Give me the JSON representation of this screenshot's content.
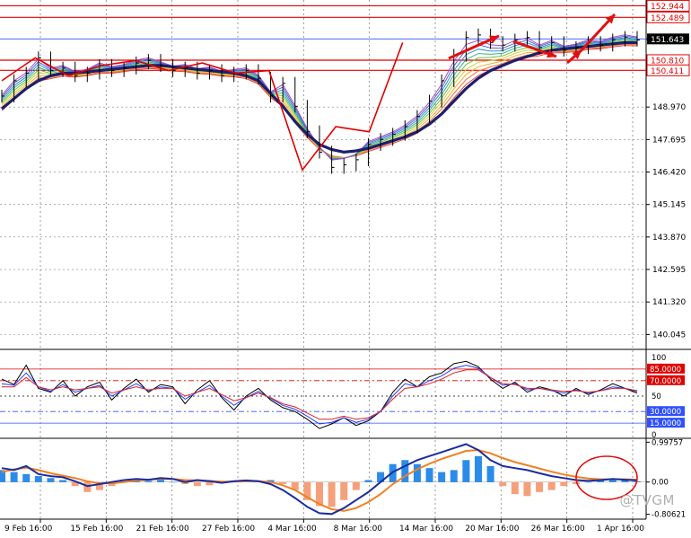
{
  "watermark": "@TVGM",
  "colors": {
    "background": "#ffffff",
    "bar": "#000000",
    "grid": "#808080",
    "red_line": "#e00000",
    "blue_line": "#3050ff",
    "ma_dark": "#1b1f6e",
    "macd_pos": "#2a8ce8",
    "macd_neg": "#f5a07a",
    "macd_line": "#1b2da0",
    "signal_line": "#f08020",
    "rsi_black": "#000000",
    "rsi_blue": "#2040ff",
    "rsi_red": "#e02020"
  },
  "chart_data": [
    {
      "type": "line",
      "panel": "price",
      "ylim": [
        139.6,
        153.1
      ],
      "y_ticks": [
        "152.944",
        "152.489",
        "151.643",
        "150.810",
        "150.411",
        "148.970",
        "147.695",
        "146.420",
        "145.145",
        "143.870",
        "142.595",
        "141.320",
        "140.045"
      ],
      "y_tick_values": [
        152.944,
        152.489,
        151.643,
        150.81,
        150.411,
        148.97,
        147.695,
        146.42,
        145.145,
        143.87,
        142.595,
        141.32,
        140.045
      ],
      "highlighted_levels": [
        {
          "label": "152.944",
          "value": 152.944,
          "color": "red"
        },
        {
          "label": "152.489",
          "value": 152.489,
          "color": "red"
        },
        {
          "label": "151.643",
          "value": 151.643,
          "color": "blue"
        },
        {
          "label": "150.810",
          "value": 150.81,
          "color": "red"
        },
        {
          "label": "150.411",
          "value": 150.411,
          "color": "red"
        }
      ],
      "x_labels": [
        "9 Feb 16:00",
        "15 Feb 16:00",
        "21 Feb 16:00",
        "27 Feb 16:00",
        "4 Mar 16:00",
        "8 Mar 16:00",
        "14 Mar 16:00",
        "20 Mar 16:00",
        "26 Mar 16:00",
        "1 Apr 16:00"
      ],
      "price_path": [
        149.4,
        150.0,
        150.3,
        150.9,
        150.4,
        150.5,
        150.2,
        150.3,
        150.6,
        150.4,
        150.5,
        150.7,
        150.8,
        150.6,
        150.4,
        150.5,
        150.3,
        150.4,
        150.2,
        150.3,
        150.4,
        150.1,
        149.4,
        149.9,
        149.0,
        148.0,
        147.2,
        146.6,
        146.7,
        146.9,
        147.5,
        147.7,
        147.9,
        148.2,
        148.6,
        149.2,
        150.0,
        151.0,
        151.7,
        151.8,
        151.5,
        151.4,
        151.6,
        151.7,
        151.3,
        151.5,
        151.2,
        151.3,
        151.5,
        151.4,
        151.6,
        151.7,
        151.6
      ],
      "ma_path": [
        148.9,
        149.3,
        149.7,
        150.0,
        150.2,
        150.3,
        150.3,
        150.35,
        150.4,
        150.45,
        150.5,
        150.55,
        150.6,
        150.6,
        150.55,
        150.5,
        150.45,
        150.4,
        150.35,
        150.3,
        150.2,
        150.0,
        149.5,
        149.0,
        148.4,
        147.9,
        147.5,
        147.3,
        147.2,
        147.25,
        147.35,
        147.5,
        147.65,
        147.8,
        148.0,
        148.3,
        148.7,
        149.2,
        149.7,
        150.1,
        150.4,
        150.6,
        150.8,
        150.95,
        151.1,
        151.2,
        151.25,
        151.3,
        151.35,
        151.4,
        151.45,
        151.5,
        151.5
      ],
      "zigzag_path": [
        150.0,
        150.9,
        150.2,
        150.6,
        150.8,
        150.4,
        150.7,
        150.3,
        150.4,
        146.5,
        148.2,
        148.0,
        151.5,
        151.7,
        151.3,
        151.8,
        151.2,
        151.5,
        151.2
      ]
    },
    {
      "type": "line",
      "panel": "stochastic",
      "ylim": [
        0,
        100
      ],
      "y_ticks": [
        "100",
        "85.0000",
        "70.0000",
        "50",
        "30.0000",
        "15.0000",
        "0"
      ],
      "y_tick_values": [
        100,
        85,
        70,
        50,
        30,
        15,
        0
      ],
      "levels": [
        {
          "label": "85.0000",
          "value": 85,
          "color": "red",
          "style": "solid"
        },
        {
          "label": "70.0000",
          "value": 70,
          "color": "red",
          "style": "dashdot"
        },
        {
          "label": "50",
          "value": 50,
          "color": "black",
          "style": "dotted"
        },
        {
          "label": "30.0000",
          "value": 30,
          "color": "blue",
          "style": "dashdot"
        },
        {
          "label": "15.0000",
          "value": 15,
          "color": "blue",
          "style": "solid"
        }
      ],
      "series": [
        {
          "color": "black",
          "values": [
            72,
            65,
            90,
            60,
            55,
            70,
            50,
            62,
            68,
            45,
            60,
            72,
            55,
            65,
            62,
            40,
            58,
            70,
            48,
            32,
            50,
            60,
            45,
            35,
            30,
            20,
            8,
            14,
            22,
            12,
            18,
            30,
            55,
            72,
            62,
            75,
            80,
            92,
            95,
            88,
            72,
            60,
            68,
            55,
            62,
            58,
            50,
            60,
            52,
            58,
            66,
            60,
            54
          ]
        },
        {
          "color": "blue",
          "values": [
            66,
            64,
            80,
            62,
            56,
            65,
            55,
            60,
            64,
            50,
            58,
            66,
            57,
            62,
            60,
            46,
            55,
            64,
            50,
            38,
            48,
            56,
            47,
            38,
            33,
            24,
            14,
            16,
            22,
            16,
            20,
            30,
            50,
            66,
            62,
            70,
            76,
            86,
            90,
            86,
            74,
            64,
            66,
            58,
            60,
            57,
            54,
            58,
            54,
            57,
            62,
            60,
            56
          ]
        },
        {
          "color": "red",
          "values": [
            62,
            62,
            74,
            62,
            58,
            62,
            58,
            60,
            62,
            54,
            58,
            62,
            58,
            60,
            60,
            50,
            55,
            60,
            52,
            44,
            48,
            54,
            48,
            40,
            36,
            28,
            20,
            20,
            24,
            20,
            22,
            30,
            46,
            60,
            62,
            66,
            72,
            80,
            84,
            84,
            74,
            66,
            65,
            60,
            60,
            58,
            56,
            57,
            55,
            57,
            60,
            60,
            57
          ]
        }
      ]
    },
    {
      "type": "bar",
      "panel": "macd",
      "ylim": [
        -0.86,
        1.05
      ],
      "y_ticks": [
        "0.99757",
        "0.00",
        "-0.80621"
      ],
      "y_tick_values": [
        0.99757,
        0.0,
        -0.80621
      ],
      "histogram": [
        0.3,
        0.25,
        0.2,
        0.15,
        0.1,
        0.05,
        -0.1,
        -0.25,
        -0.2,
        -0.1,
        0.02,
        0.05,
        0.03,
        0.06,
        0.0,
        -0.05,
        -0.1,
        -0.08,
        -0.02,
        0.02,
        0.04,
        0.03,
        0.05,
        -0.05,
        -0.2,
        -0.45,
        -0.6,
        -0.62,
        -0.45,
        -0.2,
        0.05,
        0.25,
        0.45,
        0.55,
        0.45,
        0.35,
        0.25,
        0.3,
        0.55,
        0.65,
        0.4,
        -0.1,
        -0.3,
        -0.35,
        -0.25,
        -0.2,
        -0.1,
        -0.05,
        0.0,
        0.05,
        0.08,
        0.05,
        0.02
      ],
      "macd_line": [
        0.35,
        0.3,
        0.4,
        0.2,
        0.15,
        0.12,
        0.02,
        -0.1,
        -0.05,
        0.0,
        0.05,
        0.08,
        0.06,
        0.1,
        0.08,
        0.0,
        0.05,
        0.02,
        -0.02,
        0.02,
        0.04,
        0.02,
        -0.05,
        -0.2,
        -0.4,
        -0.62,
        -0.78,
        -0.8,
        -0.65,
        -0.45,
        -0.25,
        0.0,
        0.25,
        0.4,
        0.55,
        0.65,
        0.75,
        0.85,
        0.95,
        0.8,
        0.55,
        0.4,
        0.35,
        0.3,
        0.22,
        0.15,
        0.1,
        0.05,
        0.03,
        0.05,
        0.08,
        0.06,
        0.04
      ],
      "signal_line": [
        0.25,
        0.32,
        0.36,
        0.3,
        0.22,
        0.16,
        0.1,
        0.02,
        -0.03,
        -0.03,
        0.0,
        0.04,
        0.06,
        0.08,
        0.08,
        0.05,
        0.04,
        0.03,
        0.01,
        0.01,
        0.02,
        0.02,
        0.0,
        -0.08,
        -0.2,
        -0.38,
        -0.55,
        -0.68,
        -0.72,
        -0.65,
        -0.5,
        -0.3,
        -0.05,
        0.15,
        0.32,
        0.46,
        0.58,
        0.68,
        0.78,
        0.8,
        0.72,
        0.6,
        0.5,
        0.42,
        0.34,
        0.26,
        0.19,
        0.13,
        0.09,
        0.07,
        0.07,
        0.07,
        0.06
      ]
    }
  ]
}
